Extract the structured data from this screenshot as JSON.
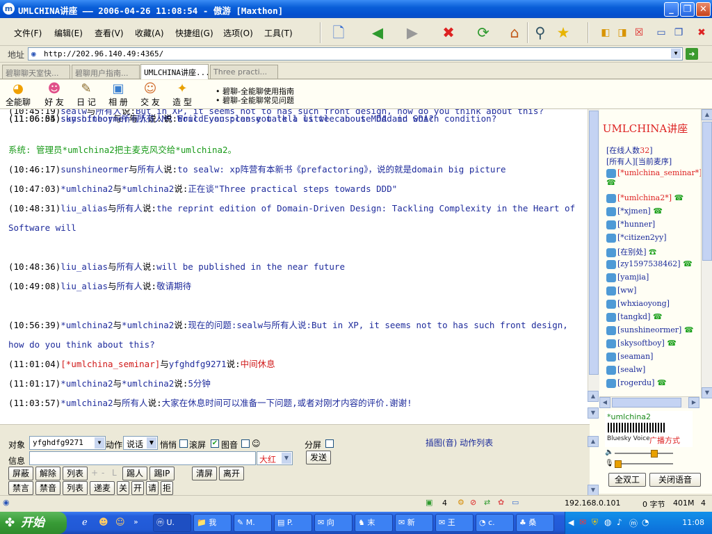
{
  "window": {
    "title": "UMLCHINA讲座 —— 2006-04-26 11:08:54 - 傲游 [Maxthon]",
    "app_icon": "m"
  },
  "menu": [
    "文件(F)",
    "编辑(E)",
    "查看(V)",
    "收藏(A)",
    "快捷组(G)",
    "选项(O)",
    "工具(T)"
  ],
  "address": {
    "label": "地址",
    "url": "http://202.96.140.49:4365/"
  },
  "tabs": [
    "碧聊聊天室快...",
    "碧聊用户指南...",
    "UMLCHINA讲座...",
    "Three practi..."
  ],
  "chat_toolbar": {
    "buttons": [
      "全能聊",
      "好 友",
      "日 记",
      "相 册",
      "交 友",
      "造 型"
    ],
    "guides": [
      "• 碧聊-全能聊使用指南",
      "• 碧聊-全能聊常见问题"
    ]
  },
  "messages": [
    {
      "time": "(10:45:19)",
      "user": "sealw",
      "target": "所有人",
      "verb": "说:",
      "text": "But in XP, it seems not to has such front design, how do you think about this?",
      "style": "blue"
    },
    {
      "system": "系统:  管理员*umlchina2把主麦克风交给*umlchina2。",
      "style": "green"
    },
    {
      "time": "(10:46:17)",
      "user": "sunshineormer",
      "target": "所有人",
      "verb": "说:",
      "text": "to sealw: xp阵营有本新书《prefactoring》，说的就是domain big picture",
      "style": "blue"
    },
    {
      "time": "(10:47:03)",
      "user": "*umlchina2",
      "target": "*umlchina2",
      "verb": "说:",
      "text": "正在谈\"Three practical steps towards DDD\"",
      "style": "blue"
    },
    {
      "time": "(10:48:31)",
      "user": "liu_alias",
      "target": "所有人",
      "verb": "说:",
      "text": "the reprint edition of Domain-Driven Design: Tackling Complexity in the Heart of Software will",
      "style": "blue"
    },
    {
      "time": "(10:48:36)",
      "user": "liu_alias",
      "target": "所有人",
      "verb": "说:",
      "text": "will be published in the near future",
      "style": "blue"
    },
    {
      "time": "(10:49:08)",
      "user": "liu_alias",
      "target": "所有人",
      "verb": "说:",
      "text": "敬请期待",
      "style": "blue"
    },
    {
      "time": "(10:56:39)",
      "user": "*umlchina2",
      "target": "*umlchina2",
      "verb": "说:",
      "text": "现在的问题:sealw与所有人说:But in XP, it seems not to has such front design, how do you think about this?",
      "style": "blue"
    },
    {
      "time": "(11:01:04)",
      "user": "[*umlchina_seminar]",
      "target": "yfghdfg9271",
      "verb": "说:",
      "text": "中间休息",
      "style": "red"
    },
    {
      "time": "(11:01:17)",
      "user": "*umlchina2",
      "target": "*umlchina2",
      "verb": "说:",
      "text": "5分钟",
      "style": "blue"
    },
    {
      "time": "(11:03:57)",
      "user": "*umlchina2",
      "target": "所有人",
      "verb": "说:",
      "text": "大家在休息时间可以准备一下问题,或者对刚才内容的评价.谢谢!",
      "style": "blue"
    },
    {
      "time": "(11:06:05)",
      "user": "skysoftboy",
      "target": "所有人",
      "verb": "说:",
      "text": "MR Eric Evans:can you tell us we can use ddd in which condition?",
      "style": "blue"
    },
    {
      "time": "(11:06:54)",
      "user": "sunshineormer",
      "target": "所有人",
      "verb": "说:",
      "text": "Would you please talk a little about MDA and SOA?",
      "style": "blue"
    }
  ],
  "with_label": "与",
  "room": {
    "title": "UMLCHINA讲座",
    "online_label": "[在线人数",
    "online_count": "32",
    "online_close": "]",
    "list_header": "[所有人][当前麦序]",
    "users": [
      {
        "name": "[*umlchina_seminar*]",
        "style": "red",
        "phone": true
      },
      {
        "name": "[*umlchina2*]",
        "style": "red",
        "phone": true
      },
      {
        "name": "[*xjmen]",
        "style": "blue",
        "phone": true
      },
      {
        "name": "[*hunner]",
        "style": "blue",
        "phone": false
      },
      {
        "name": "[*citizen2yy]",
        "style": "blue",
        "phone": false
      },
      {
        "name": "[在别处]",
        "style": "blue",
        "phone": true
      },
      {
        "name": "[zy1597538462]",
        "style": "blue",
        "phone": true
      },
      {
        "name": "[yamjia]",
        "style": "blue",
        "phone": false
      },
      {
        "name": "[ww]",
        "style": "blue",
        "phone": false
      },
      {
        "name": "[whxiaoyong]",
        "style": "blue",
        "phone": false
      },
      {
        "name": "[tangkd]",
        "style": "blue",
        "phone": true
      },
      {
        "name": "[sunshineormer]",
        "style": "blue",
        "phone": true
      },
      {
        "name": "[skysoftboy]",
        "style": "blue",
        "phone": true
      },
      {
        "name": "[seaman]",
        "style": "blue",
        "phone": false
      },
      {
        "name": "[sealw]",
        "style": "blue",
        "phone": false
      },
      {
        "name": "[rogerdu]",
        "style": "blue",
        "phone": true
      }
    ],
    "speaker": "*umlchina2",
    "voice_brand": "Bluesky Voice",
    "broadcast": "广播方式",
    "full_duplex": "全双工",
    "close_voice": "关闭语音"
  },
  "input": {
    "target_label": "对象",
    "target_value": "yfghdfg9271",
    "action_label": "动作",
    "action_value": "说话",
    "whisper": "悄悄",
    "scroll": "滚屏",
    "image": "图音",
    "emoji": "☺",
    "split": "分屏",
    "insert_link": "插图(音) 动作列表",
    "message_label": "信息",
    "color_value": "大红",
    "send": "发送",
    "row1": [
      "屏蔽",
      "解除",
      "列表",
      "踢人",
      "踢IP",
      "清屏",
      "离开"
    ],
    "row1_misc": [
      "+",
      "-",
      "L"
    ],
    "row2": [
      "禁言",
      "禁音",
      "列表",
      "递麦",
      "关",
      "开",
      "请",
      "拒"
    ]
  },
  "status": {
    "pages": "4",
    "ip": "192.168.0.101",
    "bytes": "0 字节",
    "mem": "401M",
    "count": "4"
  },
  "taskbar": {
    "start": "开始",
    "tasks": [
      "U.",
      "我",
      "M.",
      "P.",
      "向",
      "末",
      "新",
      "王",
      "c.",
      "桑"
    ],
    "clock": "11:08"
  },
  "colors": {
    "chat_blue": "#1f2c9c",
    "system_green": "#1a9a1a",
    "alert_red": "#d01818",
    "title_blue": "#0a5fd8"
  }
}
